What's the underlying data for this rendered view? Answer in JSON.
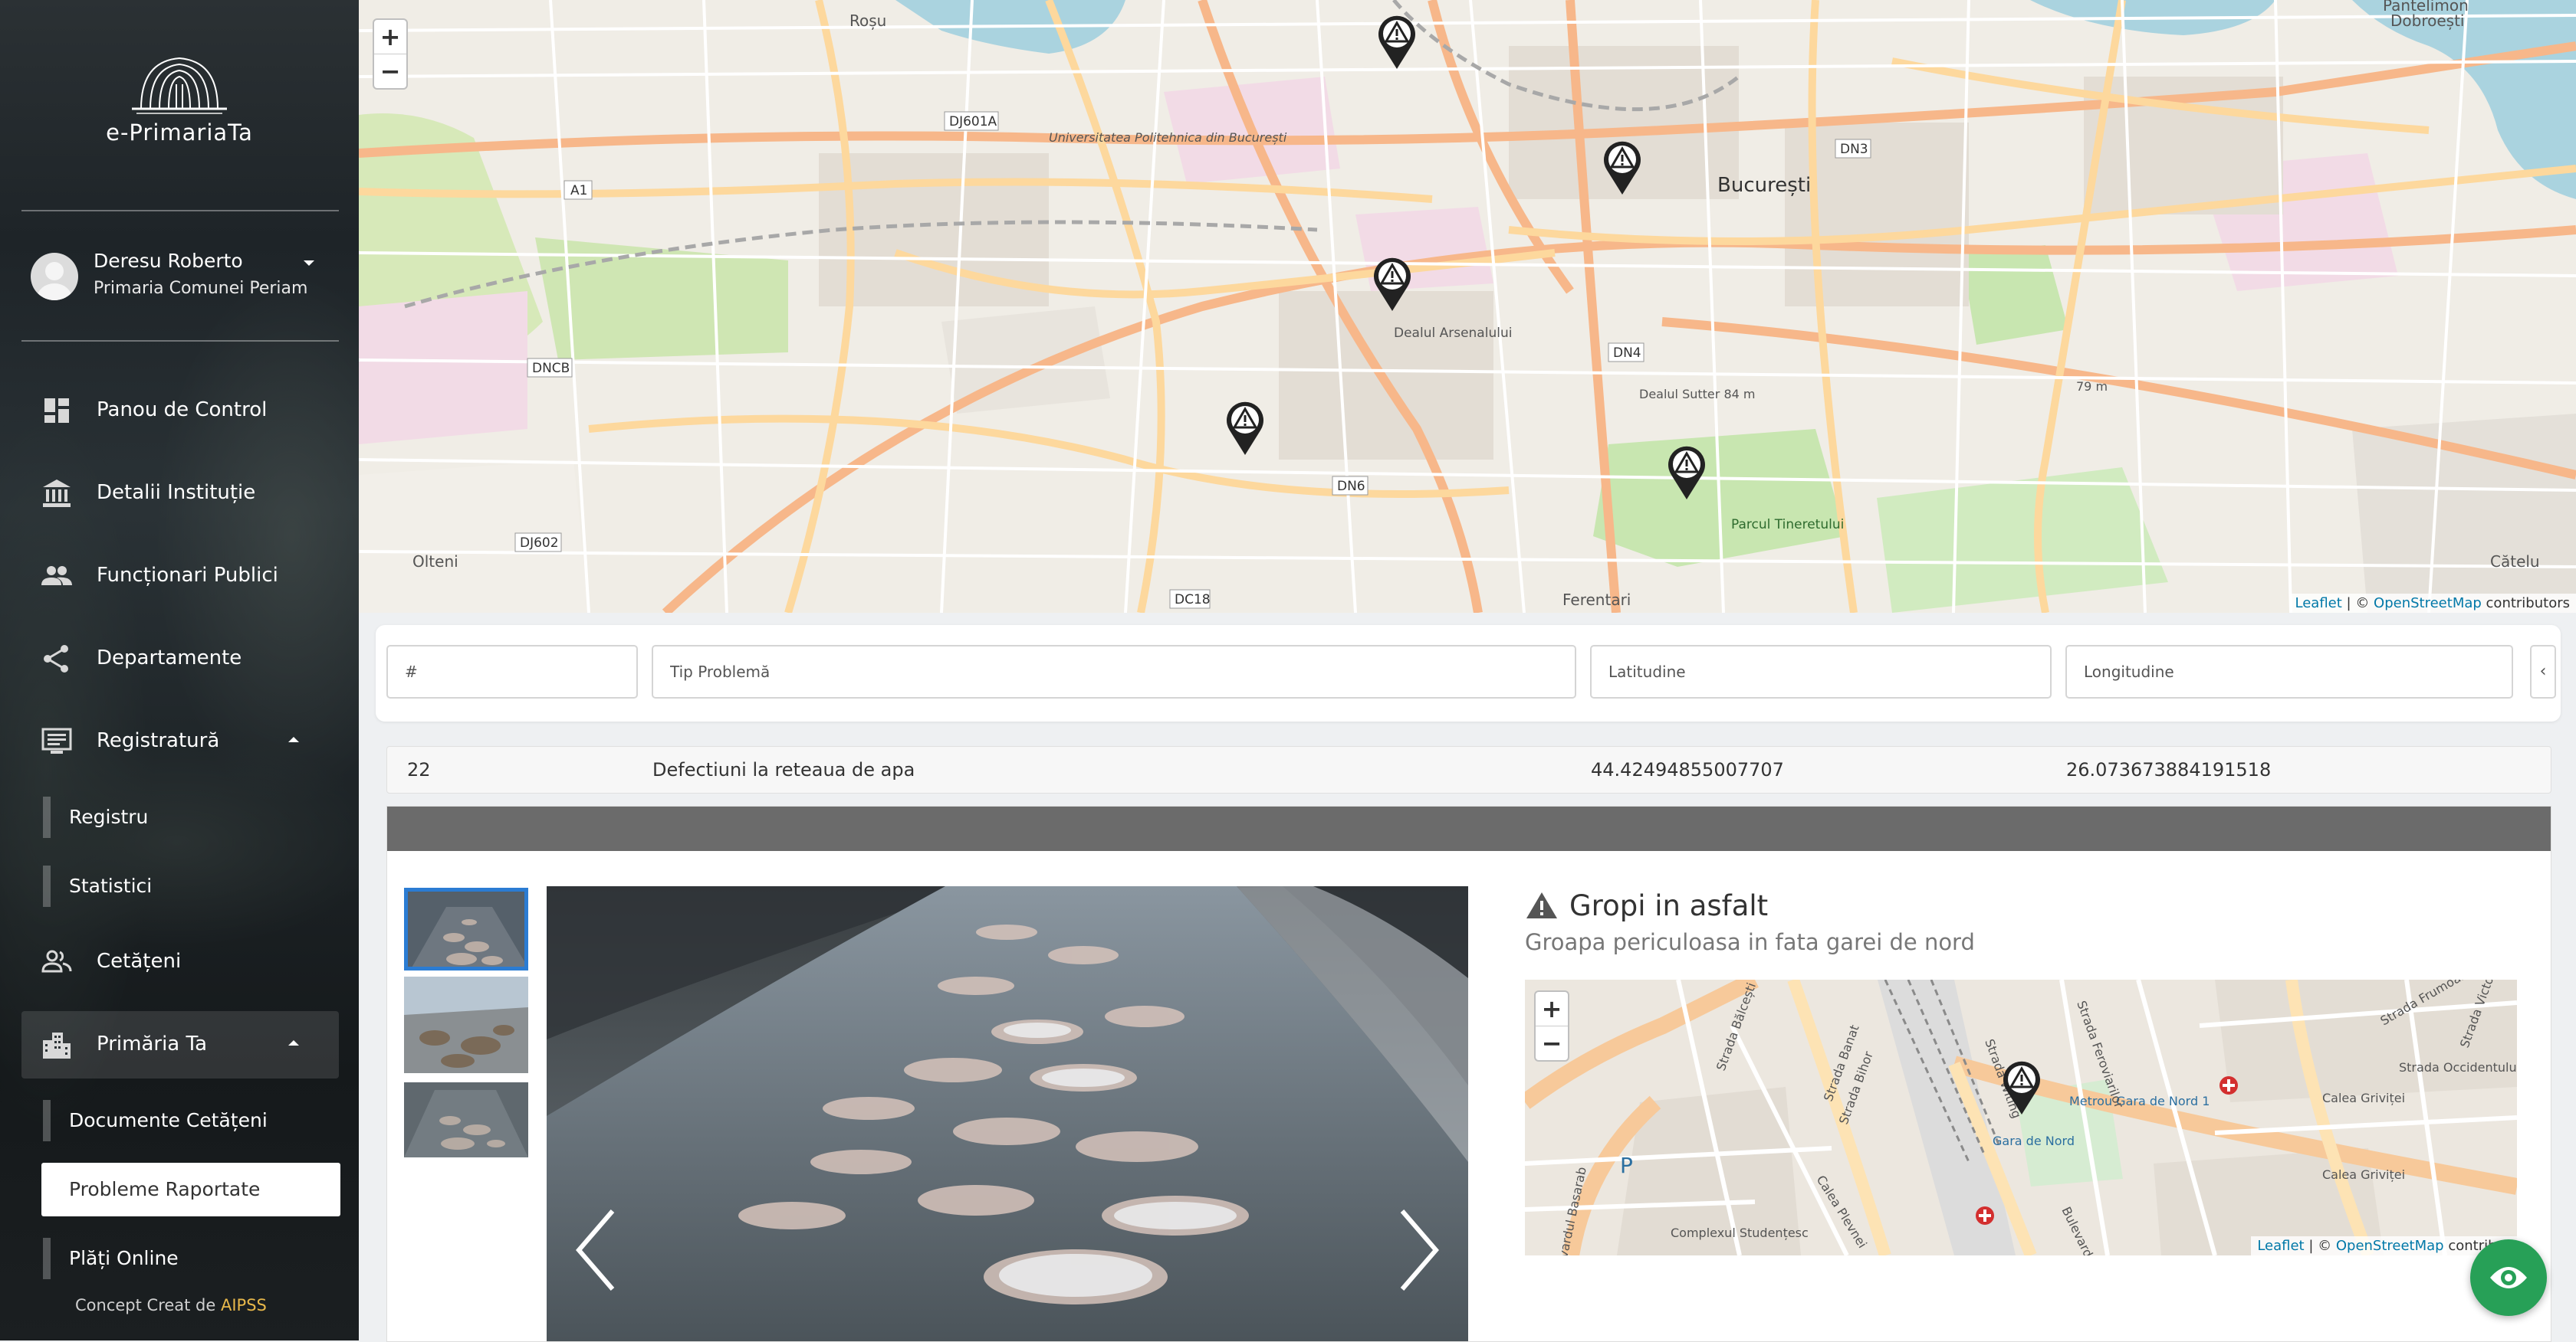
{
  "app": {
    "logo_text": "e-PrimariaTa"
  },
  "user": {
    "name": "Deresu Roberto",
    "institution": "Primaria Comunei Periam"
  },
  "nav": {
    "panou": "Panou de Control",
    "detalii": "Detalii Instituție",
    "functionari": "Funcționari Publici",
    "departamente": "Departamente",
    "registratura": "Registratură",
    "registru": "Registru",
    "statistici": "Statistici",
    "cetateni": "Cetățeni",
    "primaria": "Primăria Ta",
    "documente": "Documente Cetățeni",
    "probleme": "Probleme Raportate",
    "plati": "Plăți Online"
  },
  "footer": {
    "concept": "Concept Creat de ",
    "brand": "AIPSS"
  },
  "map": {
    "zoom_in": "+",
    "zoom_out": "−",
    "attr_leaflet": "Leaflet",
    "attr_sep": " | © ",
    "attr_osm": "OpenStreetMap",
    "attr_contrib": " contributors",
    "labels": {
      "rosu": "Roșu",
      "dobroesti": "Dobroești",
      "pantelimon": "Pantelimon",
      "bucuresti": "București",
      "olteni": "Olteni",
      "ferentari": "Ferentari",
      "catelu": "Cătelu",
      "parcul_tineretului": "Parcul Tineretului",
      "dealul_arsenalului": "Dealul Arsenalului",
      "universitatea": "Universitatea Politehnica din București",
      "dn3": "DN3",
      "dn4": "DN4",
      "dn6": "DN6",
      "dncb": "DNCB",
      "dc18": "DC18",
      "a1": "A1",
      "dj601a": "DJ601A",
      "dj602": "DJ602",
      "dealul_sutter": "Dealul Sutter 84 m",
      "m79": "79 m"
    }
  },
  "filters": {
    "id_placeholder": "#",
    "tip_placeholder": "Tip Problemă",
    "lat_placeholder": "Latitudine",
    "lng_placeholder": "Longitudine",
    "toggle": "‹"
  },
  "record": {
    "id": "22",
    "tip": "Defectiuni la reteaua de apa",
    "lat": "44.42494855007707",
    "lng": "26.073673884191518"
  },
  "problem": {
    "title": "Gropi in asfalt",
    "description": "Groapa periculoasa in fata garei de nord"
  },
  "minimap": {
    "attr_leaflet": "Leaflet",
    "attr_sep": " | © ",
    "attr_osm": "OpenStreetMap",
    "attr_contrib": " contribut",
    "labels": {
      "gara": "Gara de Nord",
      "metrou": "Metrou Gara de Nord 1",
      "calea_grivitei": "Calea Griviței",
      "complexul": "Complexul Studențesc",
      "strada_occidentului": "Strada Occidentului",
      "bd_basarab": "Bulevardul Basarab",
      "bd_dinicu": "Bulevardul Dinicu",
      "calea_plevnei": "Calea Plevnei",
      "strada_frumoasa": "Strada Frumoasă",
      "strada_victoriei": "Strada Victoriei",
      "strada_balcesti": "Strada Bălcești",
      "strada_banat": "Strada Banat",
      "strada_bihor": "Strada Bihor",
      "strada_witing": "Strada Witing",
      "strada_feroviarilor": "Strada Feroviarilor",
      "p": "P"
    }
  },
  "colors": {
    "accent": "#2b7cd3",
    "fab": "#27a057",
    "brand": "#e8b84a"
  }
}
